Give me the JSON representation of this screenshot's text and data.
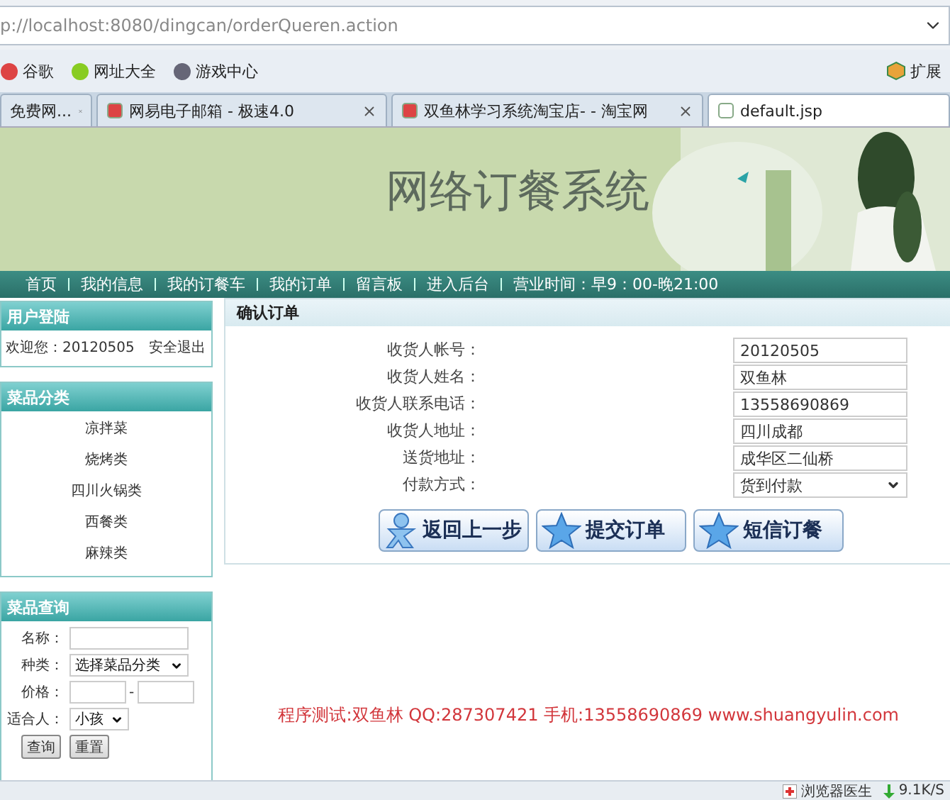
{
  "address_bar": {
    "url": "p://localhost:8080/dingcan/orderQueren.action"
  },
  "bookmarks": [
    {
      "label": "谷歌"
    },
    {
      "label": "网址大全"
    },
    {
      "label": "游戏中心"
    }
  ],
  "extensions": {
    "label": "扩展"
  },
  "tabs": [
    {
      "label": "免费网...",
      "selected": false
    },
    {
      "label": "网易电子邮箱 - 极速4.0",
      "selected": false
    },
    {
      "label": "双鱼林学习系统淘宝店- - 淘宝网",
      "selected": false
    },
    {
      "label": "default.jsp",
      "selected": true
    }
  ],
  "banner": {
    "title": "网络订餐系统"
  },
  "nav": {
    "items": [
      "首页",
      "我的信息",
      "我的订餐车",
      "我的订单",
      "留言板",
      "进入后台"
    ],
    "hours": "营业时间：早9：00-晚21:00"
  },
  "login_panel": {
    "title": "用户登陆",
    "welcome": "欢迎您：20120505",
    "logout": "安全退出"
  },
  "category_panel": {
    "title": "菜品分类",
    "items": [
      "凉拌菜",
      "烧烤类",
      "四川火锅类",
      "西餐类",
      "麻辣类"
    ]
  },
  "search_panel": {
    "title": "菜品查询",
    "name_label": "名称：",
    "type_label": "种类：",
    "type_value": "选择菜品分类",
    "price_label": "价格：",
    "price_separator": "-",
    "person_label": "适合人：",
    "person_value": "小孩",
    "buttons": [
      "查询",
      "重置"
    ]
  },
  "order_panel": {
    "title": "确认订单",
    "fields": [
      {
        "label": "收货人帐号：",
        "value": "20120505",
        "kind": "input"
      },
      {
        "label": "收货人姓名：",
        "value": "双鱼林",
        "kind": "input"
      },
      {
        "label": "收货人联系电话：",
        "value": "13558690869",
        "kind": "input"
      },
      {
        "label": "收货人地址：",
        "value": "四川成都",
        "kind": "input"
      },
      {
        "label": "送货地址：",
        "value": "成华区二仙桥",
        "kind": "input"
      },
      {
        "label": "付款方式：",
        "value": "货到付款",
        "kind": "select"
      }
    ],
    "buttons": [
      {
        "label": "返回上一步",
        "kind": "person"
      },
      {
        "label": "提交订单",
        "kind": "star"
      },
      {
        "label": "短信订餐",
        "kind": "star"
      }
    ]
  },
  "footer": {
    "text": "程序测试:双鱼林 QQ:287307421 手机:13558690869 www.shuangyulin.com"
  },
  "status_bar": {
    "doctor": "浏览器医生",
    "speed": "9.1K/S"
  }
}
